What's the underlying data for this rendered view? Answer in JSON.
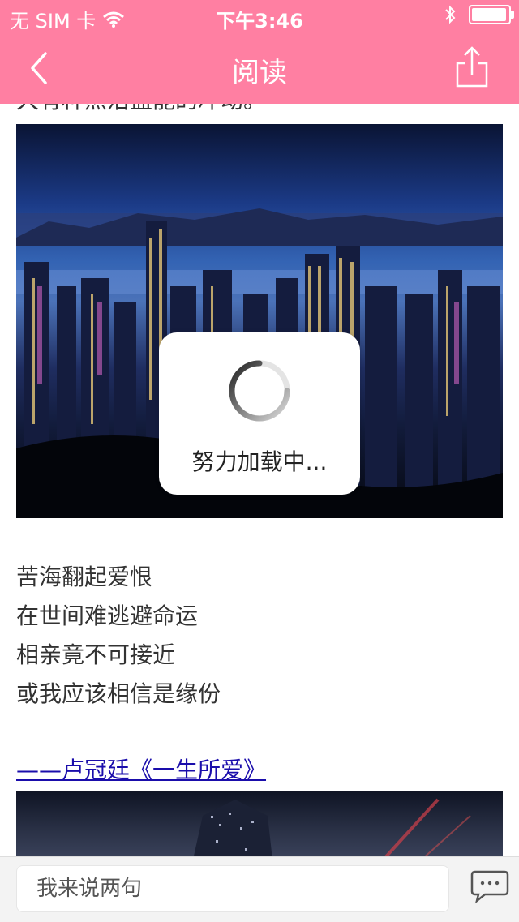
{
  "status_bar": {
    "carrier": "无 SIM 卡",
    "time": "下午3:46",
    "battery_level": 0.95
  },
  "nav": {
    "title": "阅读"
  },
  "article": {
    "cut_line": "大有种然沿盖能的冲动。",
    "poem_lines": [
      "苦海翻起爱恨",
      "在世间难逃避命运",
      "相亲竟不可接近",
      "或我应该相信是缘份"
    ],
    "credit": "——卢冠廷《一生所爱》"
  },
  "loading": {
    "text": "努力加载中..."
  },
  "comment": {
    "placeholder": "我来说两句"
  },
  "colors": {
    "brand": "#ff7fa2",
    "link": "#1a0dab"
  },
  "icons": [
    "back-icon",
    "share-icon",
    "wifi-icon",
    "bluetooth-icon",
    "battery-icon",
    "chat-icon",
    "spinner-icon"
  ]
}
